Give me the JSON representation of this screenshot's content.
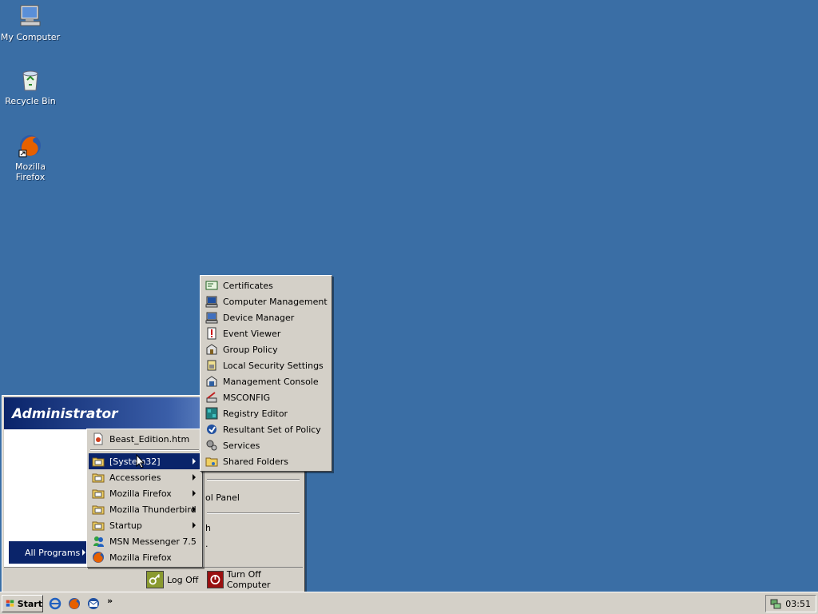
{
  "desktop": {
    "icons": [
      {
        "label": "My Computer",
        "icon": "my-computer-icon"
      },
      {
        "label": "Recycle Bin",
        "icon": "recycle-bin-icon"
      },
      {
        "label": "Mozilla Firefox",
        "icon": "firefox-icon"
      }
    ]
  },
  "start_menu": {
    "user": "Administrator",
    "right_items": {
      "control_panel": "ol Panel",
      "search": "h",
      "run": "."
    },
    "all_programs": "All Programs",
    "log_off": "Log Off",
    "turn_off": "Turn Off Computer"
  },
  "programs_menu": {
    "items": [
      {
        "label": "Beast_Edition.htm",
        "icon": "html-file-icon",
        "submenu": false
      },
      {
        "label": "[System32]",
        "icon": "program-folder-icon",
        "submenu": true,
        "active": true
      },
      {
        "label": "Accessories",
        "icon": "program-folder-icon",
        "submenu": true
      },
      {
        "label": "Mozilla Firefox",
        "icon": "program-folder-icon",
        "submenu": true
      },
      {
        "label": "Mozilla Thunderbird",
        "icon": "program-folder-icon",
        "submenu": true
      },
      {
        "label": "Startup",
        "icon": "program-folder-icon",
        "submenu": true
      },
      {
        "label": "MSN Messenger 7.5",
        "icon": "msn-messenger-icon",
        "submenu": false
      },
      {
        "label": "Mozilla Firefox",
        "icon": "firefox-icon",
        "submenu": false
      }
    ]
  },
  "system32_menu": {
    "items": [
      {
        "label": "Certificates",
        "icon": "certificates-icon"
      },
      {
        "label": "Computer Management",
        "icon": "computer-management-icon"
      },
      {
        "label": "Device Manager",
        "icon": "device-manager-icon"
      },
      {
        "label": "Event Viewer",
        "icon": "event-viewer-icon"
      },
      {
        "label": "Group Policy",
        "icon": "group-policy-icon"
      },
      {
        "label": "Local Security Settings",
        "icon": "local-security-icon"
      },
      {
        "label": "Management Console",
        "icon": "management-console-icon"
      },
      {
        "label": "MSCONFIG",
        "icon": "msconfig-icon"
      },
      {
        "label": "Registry Editor",
        "icon": "registry-editor-icon"
      },
      {
        "label": "Resultant Set of Policy",
        "icon": "rsop-icon"
      },
      {
        "label": "Services",
        "icon": "services-icon"
      },
      {
        "label": "Shared Folders",
        "icon": "shared-folders-icon"
      }
    ]
  },
  "taskbar": {
    "start_label": "Start",
    "quick_launch": [
      {
        "icon": "internet-explorer-icon"
      },
      {
        "icon": "firefox-icon"
      },
      {
        "icon": "thunderbird-icon"
      }
    ],
    "overflow": "»",
    "clock": "03:51"
  },
  "colors": {
    "desktop": "#3a6ea5",
    "menu_face": "#d4d0c8",
    "highlight": "#0a246a"
  }
}
